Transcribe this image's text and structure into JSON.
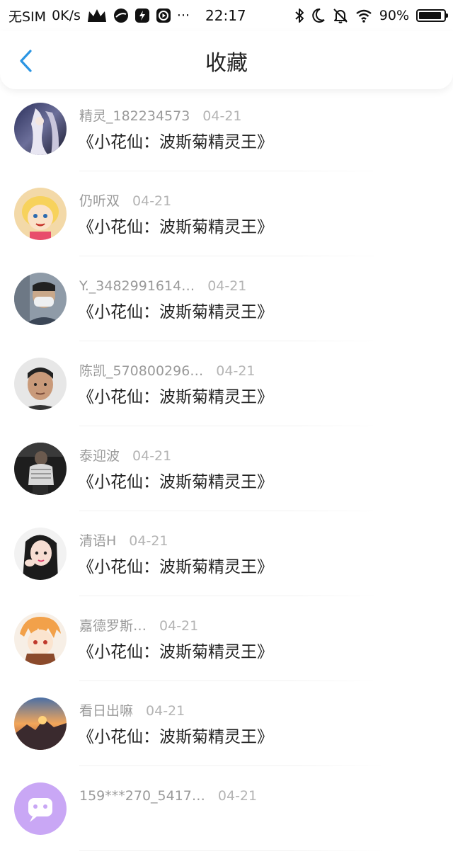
{
  "status_bar": {
    "carrier": "无SIM",
    "net_speed": "0K/s",
    "time": "22:17",
    "battery": "90%",
    "battery_level": 0.9,
    "more": "···",
    "icons": [
      "crown-icon",
      "moon-app-icon",
      "bolt-app-icon",
      "play-app-icon",
      "bluetooth-icon",
      "moon-icon",
      "bell-off-icon",
      "wifi-icon",
      "battery-icon"
    ]
  },
  "header": {
    "title": "收藏",
    "back_icon": "chevron-left-icon",
    "accent_color": "#2b95e3"
  },
  "favorites": [
    {
      "user": "精灵_182234573",
      "date": "04-21",
      "title": "《小花仙：波斯菊精灵王》",
      "avatar": "anime-dark-portrait"
    },
    {
      "user": "仍听双",
      "date": "04-21",
      "title": "《小花仙：波斯菊精灵王》",
      "avatar": "cartoon-blonde-girl"
    },
    {
      "user": "Y._3482991614…",
      "date": "04-21",
      "title": "《小花仙：波斯菊精灵王》",
      "avatar": "masked-person-photo"
    },
    {
      "user": "陈凯_570800296…",
      "date": "04-21",
      "title": "《小花仙：波斯菊精灵王》",
      "avatar": "man-portrait-photo"
    },
    {
      "user": "泰迎波",
      "date": "04-21",
      "title": "《小花仙：波斯菊精灵王》",
      "avatar": "dark-figure-photo"
    },
    {
      "user": "清语H",
      "date": "04-21",
      "title": "《小花仙：波斯菊精灵王》",
      "avatar": "girl-selfie-photo"
    },
    {
      "user": "嘉德罗斯…",
      "date": "04-21",
      "title": "《小花仙：波斯菊精灵王》",
      "avatar": "anime-orange-hair"
    },
    {
      "user": "看日出嘛",
      "date": "04-21",
      "title": "《小花仙：波斯菊精灵王》",
      "avatar": "sunset-landscape"
    },
    {
      "user": "159***270_5417…",
      "date": "04-21",
      "title": "",
      "avatar": "purple-default-avatar"
    }
  ]
}
